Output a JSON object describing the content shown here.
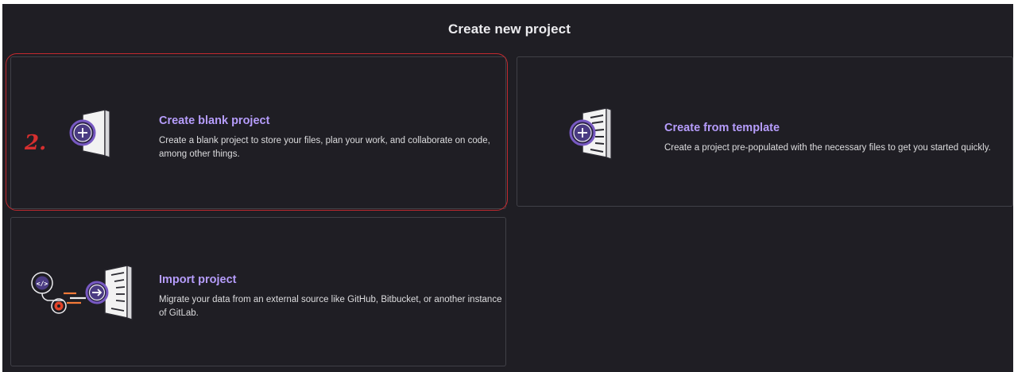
{
  "page": {
    "title": "Create new project",
    "annotation_mark": "2."
  },
  "cards": {
    "blank": {
      "title": "Create blank project",
      "description": "Create a blank project to store your files, plan your work, and collaborate on code, among other things."
    },
    "template": {
      "title": "Create from template",
      "description": "Create a project pre-populated with the necessary files to get you started quickly."
    },
    "import": {
      "title": "Import project",
      "description": "Migrate your data from an external source like GitHub, Bitbucket, or another instance of GitLab."
    }
  },
  "icons": {
    "blank": "document-plus-icon",
    "template": "template-document-plus-icon",
    "import": "import-arrow-icon"
  },
  "colors": {
    "background": "#1f1e24",
    "card_border": "#404047",
    "card_title": "#b69dfc",
    "icon_accent": "#7759c2",
    "annotation": "#d62f2f"
  }
}
